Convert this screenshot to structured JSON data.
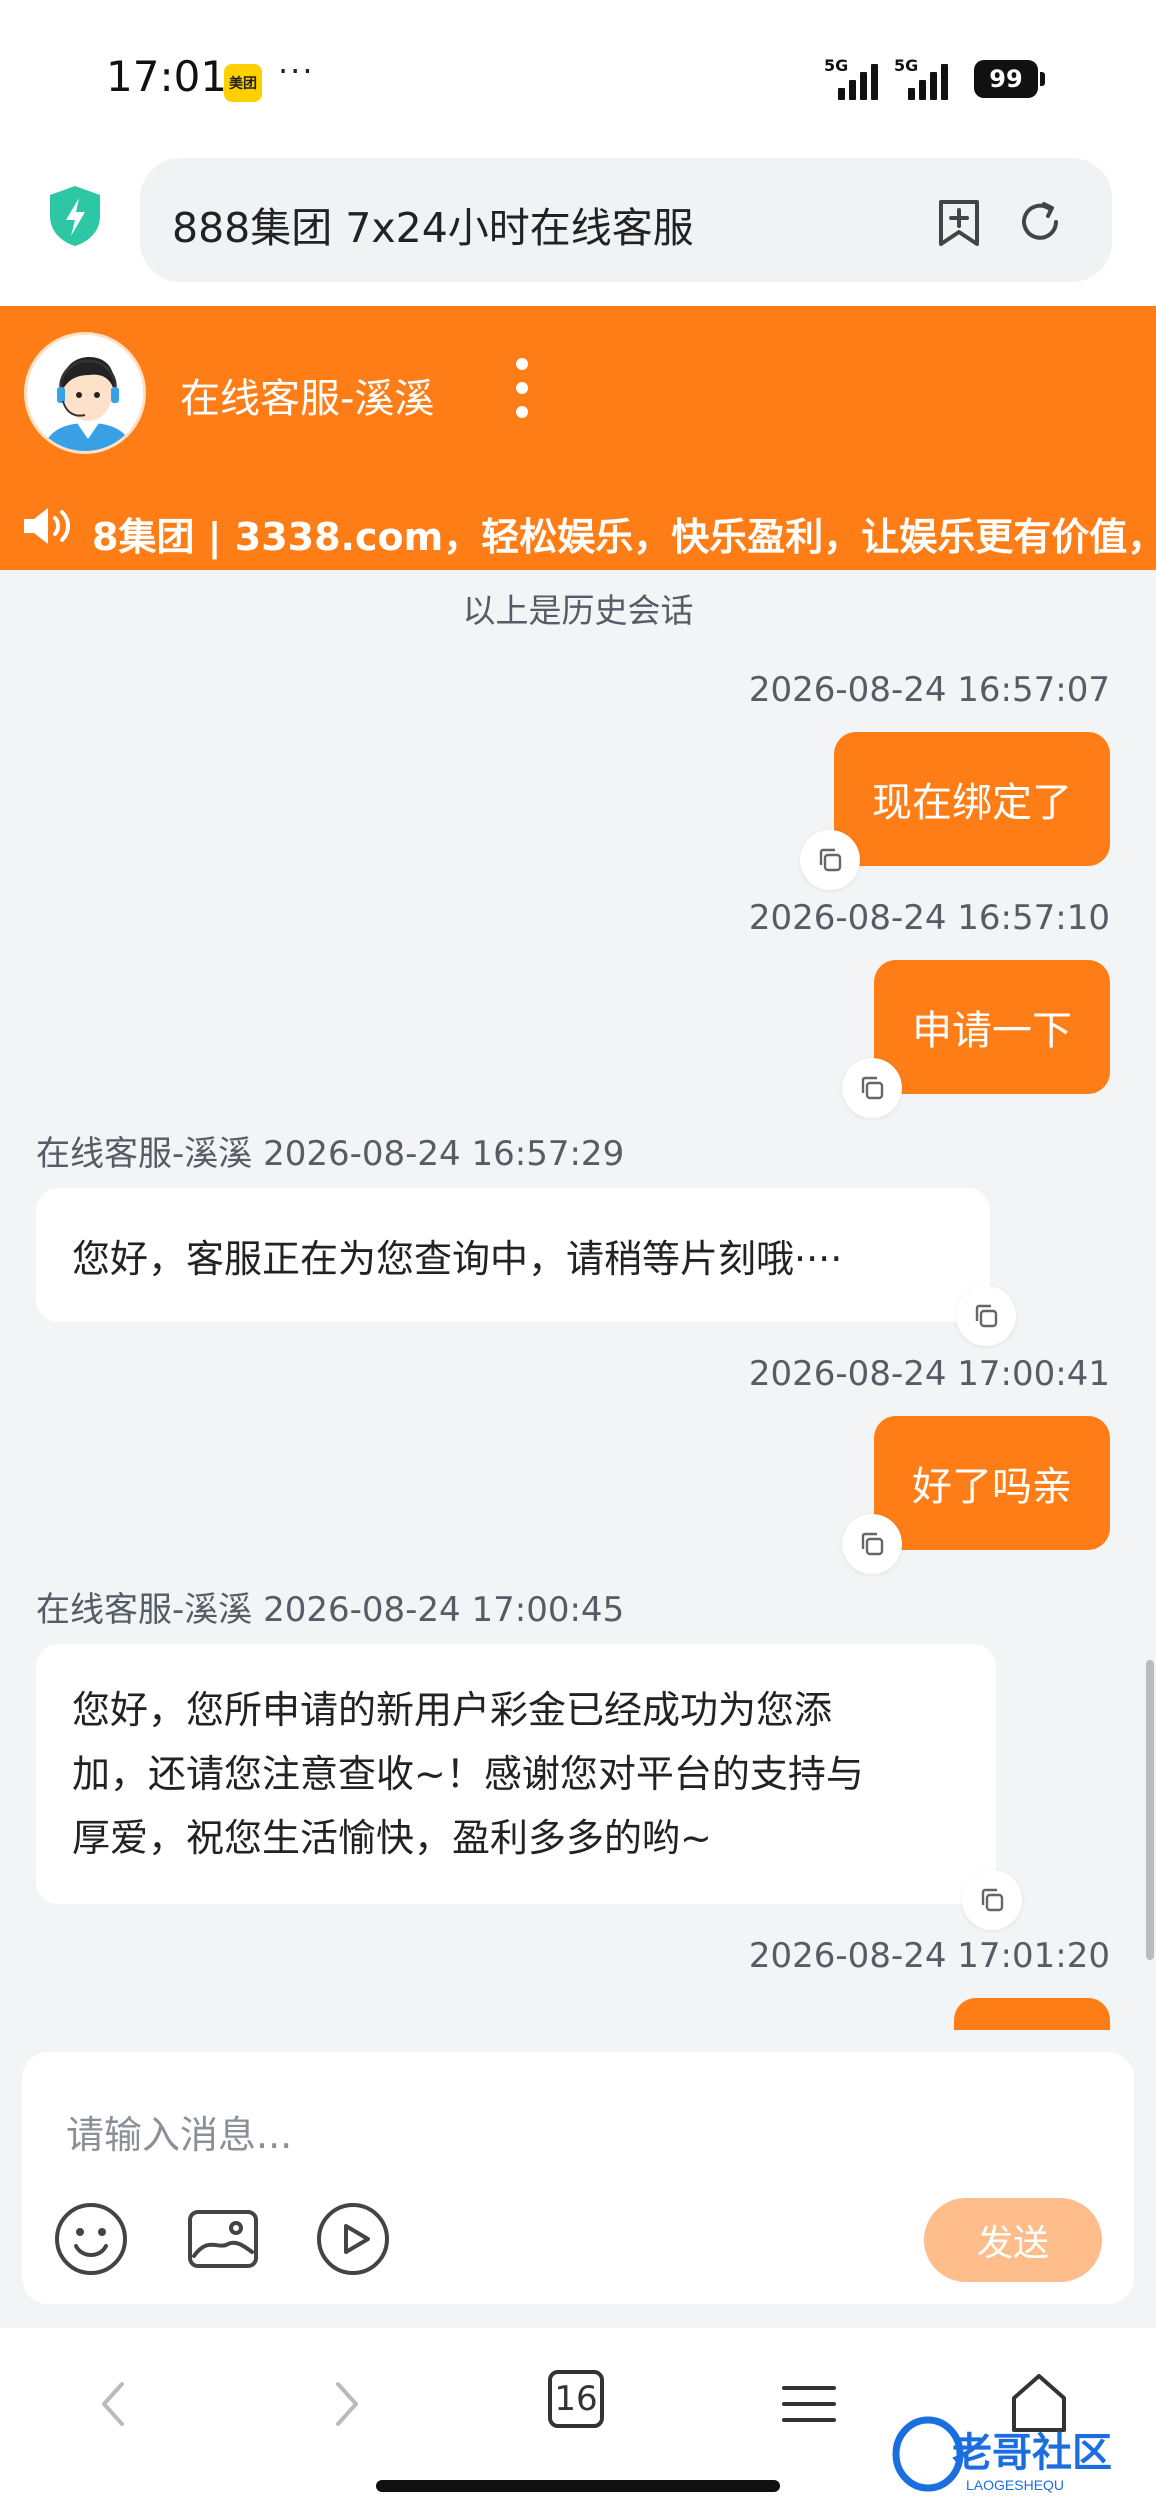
{
  "status_bar": {
    "time": "17:01",
    "meituan_label": "美团",
    "more": "···",
    "signal_1": "5G",
    "signal_2": "5G",
    "battery": "99"
  },
  "browser": {
    "url_title": "888集团 7x24小时在线客服"
  },
  "header": {
    "agent_name": "在线客服-溪溪",
    "marquee": "8集团 | 3338.com，轻松娱乐，快乐盈利，让娱乐更有价值，"
  },
  "chat": {
    "history_note": "以上是历史会话",
    "messages": [
      {
        "direction": "out",
        "time": "2026-08-24 16:57:07",
        "text": "现在绑定了"
      },
      {
        "direction": "out",
        "time": "2026-08-24 16:57:10",
        "text": "申请一下"
      },
      {
        "direction": "in",
        "sender": "在线客服-溪溪",
        "time": "2026-08-24 16:57:29",
        "text": "您好，客服正在为您查询中，请稍等片刻哦····"
      },
      {
        "direction": "out",
        "time": "2026-08-24 17:00:41",
        "text": "好了吗亲"
      },
      {
        "direction": "in",
        "sender": "在线客服-溪溪",
        "time": "2026-08-24 17:00:45",
        "lines": [
          "您好，您所申请的新用户彩金已经成功为您添",
          "加，还请您注意查收~！感谢您对平台的支持与",
          "厚爱，祝您生活愉快，盈利多多的哟~"
        ]
      },
      {
        "direction": "out",
        "time": "2026-08-24 17:01:20",
        "text": ""
      }
    ]
  },
  "composer": {
    "placeholder": "请输入消息...",
    "send_label": "发送"
  },
  "bottom_nav": {
    "tab_count": "16"
  },
  "watermark": {
    "text": "老哥社区",
    "sub": "LAOGESHEQU"
  },
  "colors": {
    "accent": "#ff7d17",
    "send_disabled": "#ffbd8c",
    "shield": "#2ec7a5"
  }
}
